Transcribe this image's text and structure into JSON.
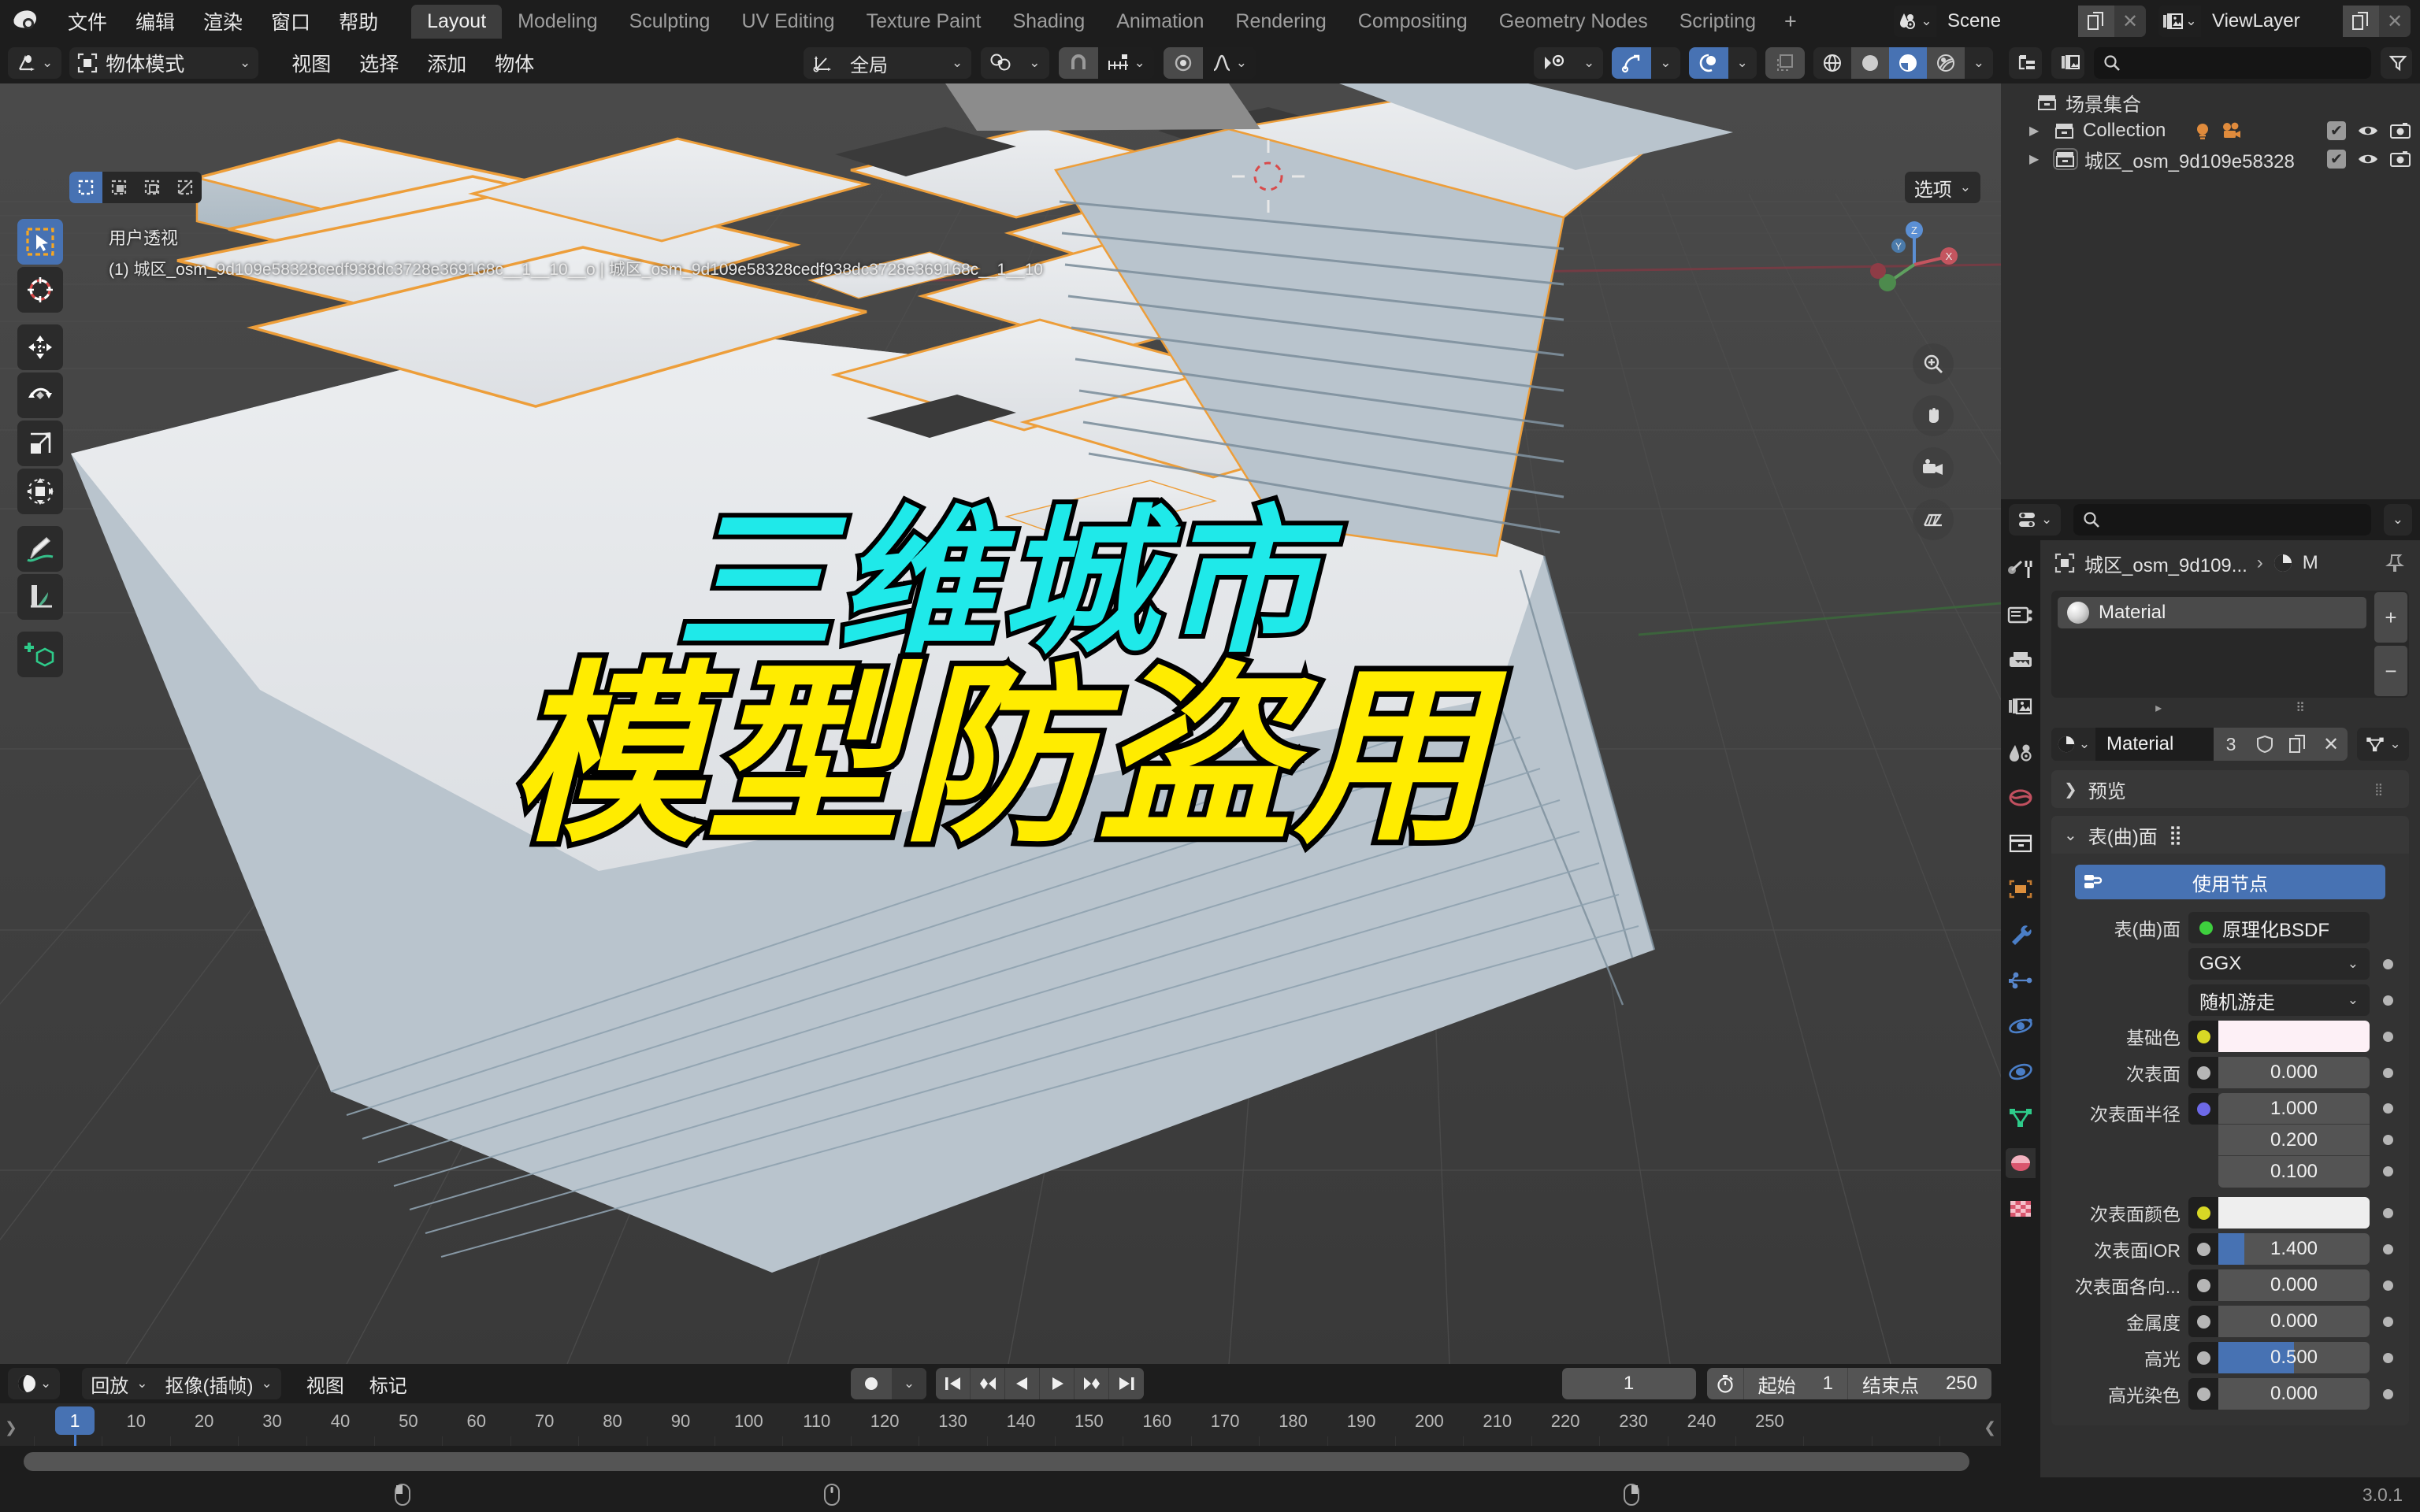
{
  "app": {
    "title": "Blender",
    "version": "3.0.1"
  },
  "topbar": {
    "logo_icon": "blender-logo-icon",
    "menus": [
      "文件",
      "编辑",
      "渲染",
      "窗口",
      "帮助"
    ],
    "workspaces": [
      {
        "label": "Layout",
        "active": true
      },
      {
        "label": "Modeling",
        "active": false
      },
      {
        "label": "Sculpting",
        "active": false
      },
      {
        "label": "UV Editing",
        "active": false
      },
      {
        "label": "Texture Paint",
        "active": false
      },
      {
        "label": "Shading",
        "active": false
      },
      {
        "label": "Animation",
        "active": false
      },
      {
        "label": "Rendering",
        "active": false
      },
      {
        "label": "Compositing",
        "active": false
      },
      {
        "label": "Geometry Nodes",
        "active": false
      },
      {
        "label": "Scripting",
        "active": false
      }
    ],
    "add_workspace_label": "+",
    "scene": {
      "icon": "scene-icon",
      "name": "Scene",
      "copy_icon": "new-scene-icon",
      "unlink_icon": "x-icon"
    },
    "viewlayer": {
      "icon": "viewlayer-icon",
      "name": "ViewLayer",
      "copy_icon": "new-viewlayer-icon",
      "unlink_icon": "x-icon"
    }
  },
  "viewport_header": {
    "editor_type_icon": "editor-type-3dview-icon",
    "mode": {
      "icon": "object-mode-icon",
      "label": "物体模式"
    },
    "menus": [
      "视图",
      "选择",
      "添加",
      "物体"
    ],
    "transform_orientation": {
      "icon": "orientation-icon",
      "label": "全局"
    },
    "pivot_icon": "pivot-point-icon",
    "snap_icon": "snap-magnet-icon",
    "snap_target_icon": "snap-increment-icon",
    "proportional_icon": "proportional-edit-icon",
    "falloff_icon": "falloff-curve-icon",
    "right_tools": {
      "visibility_icon": "object-types-visibility-icon",
      "gizmo_icon": "gizmo-icon",
      "overlays_icon": "overlays-icon",
      "xray_icon": "xray-toggle-icon",
      "shading_wireframe_icon": "shading-wireframe-icon",
      "shading_solid_icon": "shading-solid-icon",
      "shading_material_icon": "shading-material-preview-icon",
      "shading_rendered_icon": "shading-rendered-icon",
      "shading_dropdown_icon": "chevron-down-icon"
    }
  },
  "viewport": {
    "select_modes": [
      "set-select-icon",
      "extend-select-icon",
      "subtract-select-icon",
      "invert-select-icon"
    ],
    "options_label": "选项",
    "overlay_line1": "用户透视",
    "overlay_line2": "(1) 城区_osm_9d109e58328cedf938dc3728e369168c__1__10__o | 城区_osm_9d109e58328cedf938dc3728e369168c__1__10",
    "tools": [
      {
        "name": "tweak-select-box-tool",
        "active": true
      },
      {
        "name": "cursor-tool",
        "active": false
      },
      {
        "name": "move-tool",
        "active": false
      },
      {
        "name": "rotate-tool",
        "active": false
      },
      {
        "name": "scale-tool",
        "active": false
      },
      {
        "name": "transform-tool",
        "active": false
      },
      {
        "name": "annotate-tool",
        "active": false
      },
      {
        "name": "measure-tool",
        "active": false
      },
      {
        "name": "add-cube-tool",
        "active": false
      }
    ],
    "navigation": [
      "zoom-icon",
      "pan-hand-icon",
      "camera-view-icon",
      "toggle-ortho-icon"
    ],
    "gizmo_axes": [
      "X",
      "Y",
      "Z"
    ],
    "captions": {
      "line1": "三维城市",
      "line1_color": "#1fe9e9",
      "line2": "模型防盗用",
      "line2_color": "#ffec00"
    }
  },
  "outliner": {
    "display_mode_icon": "outliner-view-layer-icon",
    "filter_scene_icon": "scene-data-icon",
    "search_icon": "search-icon",
    "search_value": "",
    "search_placeholder": "",
    "filter_icon": "filter-funnel-icon",
    "rows": [
      {
        "label": "场景集合",
        "icon": "collection-icon",
        "indent": 0,
        "expander": "",
        "selected": false,
        "mid_icons": [],
        "right_icons": []
      },
      {
        "label": "Collection",
        "icon": "collection-icon",
        "indent": 1,
        "expander": "▶",
        "selected": false,
        "mid_icons": [
          "light-icon",
          "camera-icon"
        ],
        "right_icons": [
          "checkbox-checked",
          "eye-icon",
          "camera-render-icon"
        ]
      },
      {
        "label": "城区_osm_9d109e58328",
        "icon": "collection-icon",
        "indent": 1,
        "expander": "▶",
        "selected": true,
        "mid_icons": [],
        "right_icons": [
          "checkbox-checked",
          "eye-icon",
          "camera-render-icon"
        ]
      }
    ]
  },
  "properties": {
    "editor_icon": "properties-editor-icon",
    "search_icon": "search-icon",
    "search_value": "",
    "options_icon": "chevron-down-icon",
    "tabs": [
      {
        "name": "tool-tab",
        "icon": "tool-wrench-screwdriver-icon",
        "active": true
      },
      {
        "name": "render-tab",
        "icon": "render-camera-back-icon",
        "active": false
      },
      {
        "name": "output-tab",
        "icon": "output-printer-icon",
        "active": false
      },
      {
        "name": "view-layer-tab",
        "icon": "view-layer-images-icon",
        "active": false
      },
      {
        "name": "scene-tab",
        "icon": "scene-cone-sphere-icon",
        "active": false
      },
      {
        "name": "world-tab",
        "icon": "world-globe-icon",
        "active": false
      },
      {
        "name": "collection-tab",
        "icon": "collection-box-icon",
        "active": false
      },
      {
        "name": "object-tab",
        "icon": "object-orange-square-icon",
        "active": false
      },
      {
        "name": "modifier-tab",
        "icon": "modifier-wrench-icon",
        "active": false
      },
      {
        "name": "particles-tab",
        "icon": "particles-icon",
        "active": false
      },
      {
        "name": "physics-tab",
        "icon": "physics-orbit-icon",
        "active": false
      },
      {
        "name": "constraints-tab",
        "icon": "constraints-icon",
        "active": false
      },
      {
        "name": "data-tab",
        "icon": "object-data-mesh-icon",
        "active": false
      },
      {
        "name": "material-tab",
        "icon": "material-sphere-icon",
        "active": true
      },
      {
        "name": "texture-tab",
        "icon": "texture-checker-icon",
        "active": false
      }
    ],
    "breadcrumb": {
      "object_icon": "object-icon",
      "object_name": "城区_osm_9d109...",
      "separator": "›",
      "material_icon": "material-sphere-icon",
      "material_short": "M",
      "pin_icon": "pin-icon"
    },
    "material_slots": {
      "slots": [
        {
          "name": "Material",
          "icon": "material-preview-ball"
        }
      ],
      "add_label": "+",
      "remove_label": "−"
    },
    "material_id": {
      "browse_icon": "material-browse-icon",
      "name": "Material",
      "users_count": "3",
      "shield_icon": "fake-user-shield-icon",
      "copy_icon": "new-material-icon",
      "unlink_icon": "x-icon",
      "data_icon": "mesh-data-icon"
    },
    "panels": [
      {
        "label": "预览",
        "open": false,
        "grip_icon": "grip-dots-icon"
      },
      {
        "label": "表(曲)面",
        "open": true,
        "grip_icon": "grip-dots-icon"
      }
    ],
    "use_nodes": {
      "label": "使用节点",
      "icon": "nodetree-icon",
      "color": "#4772b3"
    },
    "surface": {
      "surface_label": "表(曲)面",
      "shader_name": "原理化BSDF",
      "shader_socket_color": "#3ecf3e",
      "distribution": "GGX",
      "subsurface_method": "随机游走",
      "fields": [
        {
          "label": "基础色",
          "type": "color",
          "value": "#fdf0f6",
          "socket": "#d8d825"
        },
        {
          "label": "次表面",
          "type": "slider",
          "value": "0.000",
          "fill": 0,
          "socket": "#b6b6b6"
        },
        {
          "label": "次表面半径",
          "type": "multi",
          "values": [
            "1.000",
            "0.200",
            "0.100"
          ],
          "socket": "#6d69e8"
        },
        {
          "label": "次表面颜色",
          "type": "color",
          "value": "#eeeeee",
          "socket": "#d8d825"
        },
        {
          "label": "次表面IOR",
          "type": "slider",
          "value": "1.400",
          "fill": 17,
          "socket": "#b6b6b6"
        },
        {
          "label": "次表面各向...",
          "type": "slider",
          "value": "0.000",
          "fill": 0,
          "socket": "#b6b6b6"
        },
        {
          "label": "金属度",
          "type": "slider",
          "value": "0.000",
          "fill": 0,
          "socket": "#b6b6b6"
        },
        {
          "label": "高光",
          "type": "slider",
          "value": "0.500",
          "fill": 50,
          "socket": "#b6b6b6"
        },
        {
          "label": "高光染色",
          "type": "slider",
          "value": "0.000",
          "fill": 0,
          "socket": "#b6b6b6"
        }
      ]
    }
  },
  "timeline": {
    "editor_icon": "timeline-editor-icon",
    "menus": [
      {
        "label": "回放",
        "dropdown": true
      },
      {
        "label": "抠像(插帧)",
        "dropdown": true
      },
      {
        "label": "视图",
        "dropdown": false
      },
      {
        "label": "标记",
        "dropdown": false
      }
    ],
    "record_icon": "auto-keying-record-icon",
    "record_dropdown_icon": "chevron-down-icon",
    "playback_buttons": [
      "jump-to-start-icon",
      "jump-prev-keyframe-icon",
      "play-reverse-icon",
      "play-icon",
      "jump-next-keyframe-icon",
      "jump-to-end-icon"
    ],
    "current_frame": "1",
    "timer_icon": "timer-icon",
    "start_label": "起始",
    "start_value": "1",
    "end_label": "结束点",
    "end_value": "250",
    "ruler_ticks": [
      1,
      10,
      20,
      30,
      40,
      50,
      60,
      70,
      80,
      90,
      100,
      110,
      120,
      130,
      140,
      150,
      160,
      170,
      180,
      190,
      200,
      210,
      220,
      230,
      240,
      250
    ],
    "playhead_frame": 1
  },
  "statusbar": {
    "mouse_icons": [
      "mouse-left-icon",
      "mouse-middle-icon",
      "mouse-right-icon"
    ],
    "version": "3.0.1"
  },
  "colors": {
    "accent_blue": "#4772b3",
    "selection_orange": "#ed9e3a",
    "bg_dark": "#1d1d1d",
    "bg_panel": "#303030",
    "viewport_bg": "#3d3d3d"
  }
}
